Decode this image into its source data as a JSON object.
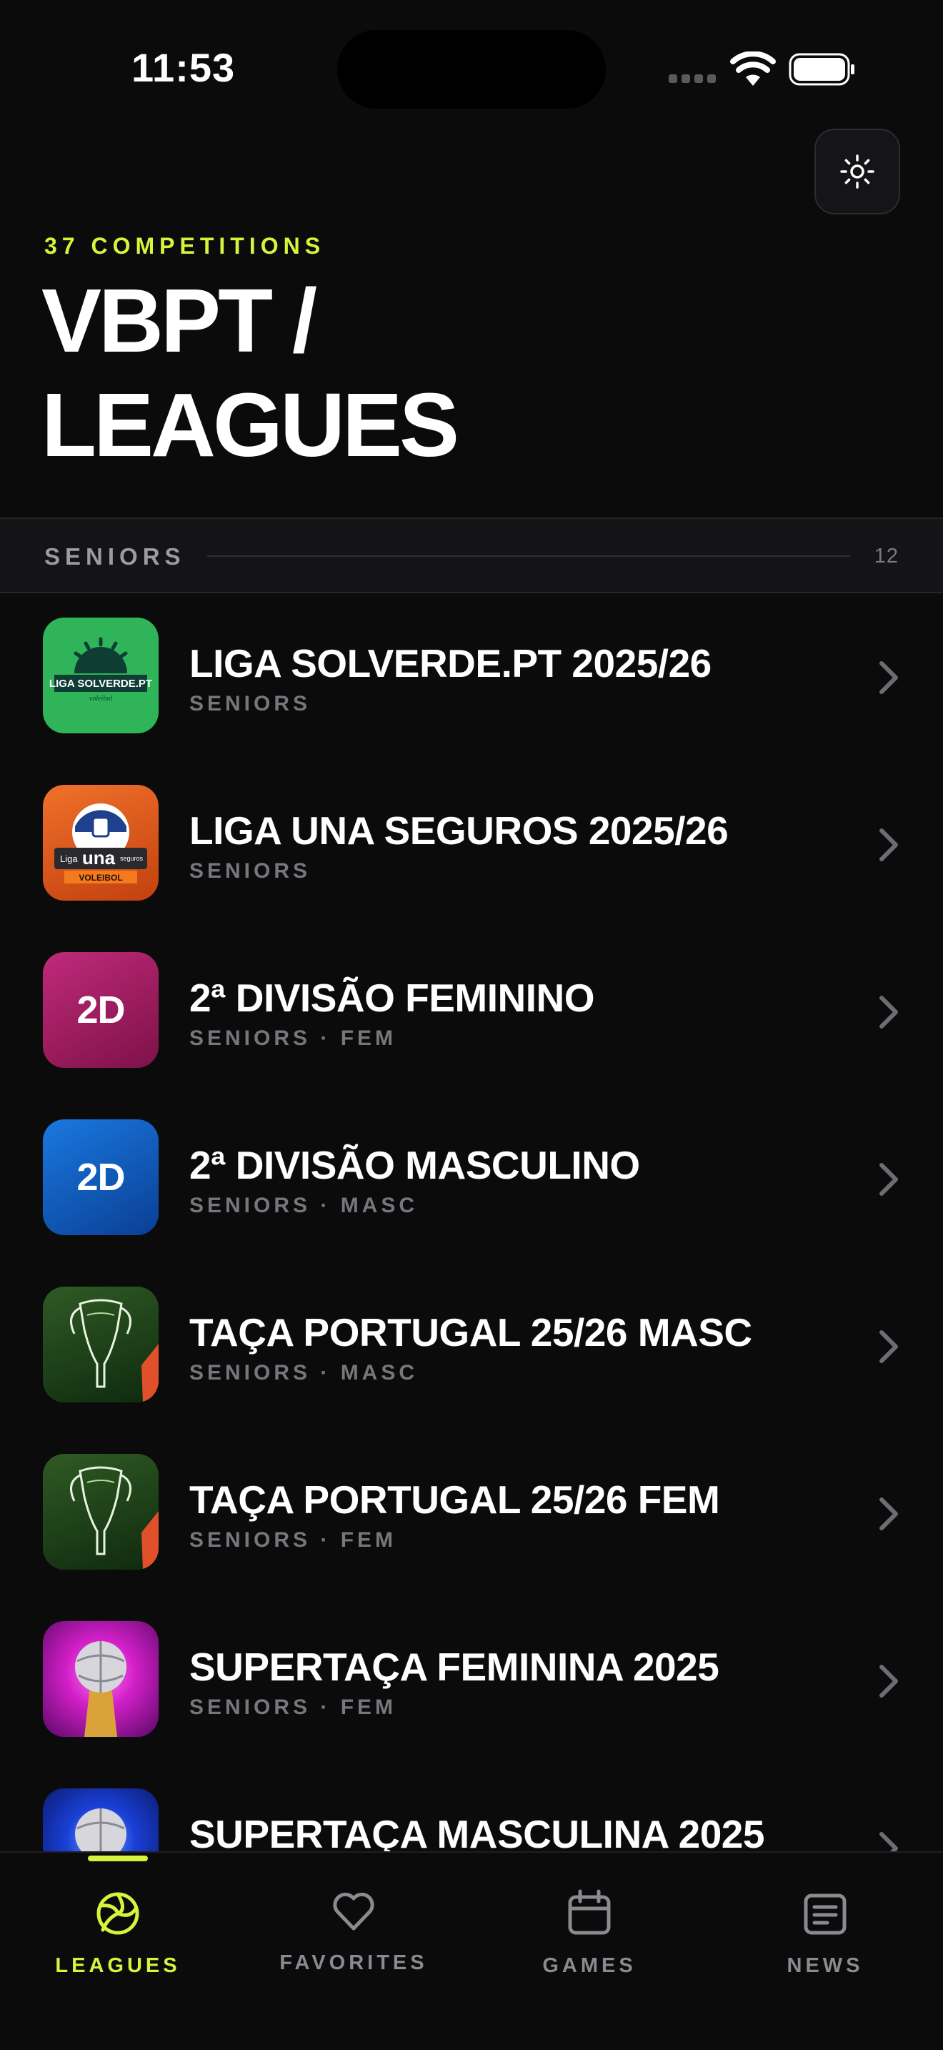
{
  "status_bar": {
    "time": "11:53"
  },
  "header": {
    "kicker": "37 COMPETITIONS",
    "title_line1": "VBPT /",
    "title_line2": "LEAGUES",
    "settings_icon": "sun-icon"
  },
  "section": {
    "label": "SENIORS",
    "count": "12"
  },
  "competitions": [
    {
      "title": "LIGA SOLVERDE.PT 2025/26",
      "subtitle": "SENIORS",
      "logo": "liga-solverde-logo",
      "logo_text_main": "LIGA SOLVERDE.PT",
      "logo_text_small": "voleibol",
      "color": "#2fb45a"
    },
    {
      "title": "LIGA UNA SEGUROS 2025/26",
      "subtitle": "SENIORS",
      "logo": "liga-una-seguros-logo",
      "logo_text_liga": "Liga",
      "logo_text_main": "una",
      "logo_text_seguros": "seguros",
      "logo_text_small": "VOLEIBOL",
      "color": "#e0561c"
    },
    {
      "title": "2ª DIVISÃO FEMININO",
      "subtitle": "SENIORS · FEM",
      "logo": "2d-logo",
      "logo_text": "2D",
      "color": "#a3195f"
    },
    {
      "title": "2ª DIVISÃO MASCULINO",
      "subtitle": "SENIORS · MASC",
      "logo": "2d-logo",
      "logo_text": "2D",
      "color": "#0f5fc2"
    },
    {
      "title": "TAÇA PORTUGAL 25/26 MASC",
      "subtitle": "SENIORS · MASC",
      "logo": "trophy-logo",
      "color": "#1f4d1f"
    },
    {
      "title": "TAÇA PORTUGAL 25/26 FEM",
      "subtitle": "SENIORS · FEM",
      "logo": "trophy-logo",
      "color": "#1f4d1f"
    },
    {
      "title": "SUPERTAÇA FEMININA 2025",
      "subtitle": "SENIORS · FEM",
      "logo": "supercup-trophy-logo",
      "color": "#d21fc8"
    },
    {
      "title": "SUPERTAÇA MASCULINA 2025",
      "subtitle": "",
      "logo": "supercup-trophy-logo",
      "color": "#1a3fd6"
    }
  ],
  "tabs": [
    {
      "label": "LEAGUES",
      "icon": "volleyball-icon",
      "active": true
    },
    {
      "label": "FAVORITES",
      "icon": "heart-icon",
      "active": false
    },
    {
      "label": "GAMES",
      "icon": "calendar-icon",
      "active": false
    },
    {
      "label": "NEWS",
      "icon": "newspaper-icon",
      "active": false
    }
  ],
  "colors": {
    "accent": "#d4f53c",
    "background": "#0b0b0c"
  }
}
